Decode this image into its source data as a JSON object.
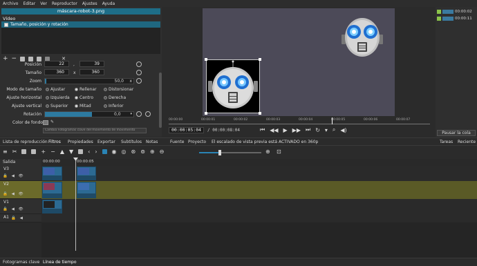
{
  "menu": [
    "Archivo",
    "Editar",
    "Ver",
    "Reproductor",
    "Ajustes",
    "Ayuda"
  ],
  "filters": {
    "title": "máscara-robot-3.png",
    "video_label": "Vídeo",
    "items": [
      {
        "label": "Tamaño, posición y rotación",
        "checked": true
      }
    ]
  },
  "props": {
    "posicion_label": "Posición",
    "pos_x": "22",
    "pos_y": "39",
    "tamano_label": "Tamaño",
    "size_w": "360",
    "size_h": "360",
    "zoom_label": "Zoom",
    "zoom_value": "50,0",
    "modo_label": "Modo de tamaño",
    "modo_options": [
      "Ajustar",
      "Rellenar",
      "Distorsionar"
    ],
    "horiz_label": "Ajuste horizontal",
    "horiz_options": [
      "Izquierda",
      "Centro",
      "Derecha"
    ],
    "vert_label": "Ajuste vertical",
    "vert_options": [
      "Superior",
      "Mitad",
      "Inferior"
    ],
    "rot_label": "Rotación",
    "rot_value": "0,0",
    "fondo_label": "Color de fondo",
    "keyframes_hint": "Cambia Fotogramas clave del movimiento de movimiento"
  },
  "player": {
    "ruler": [
      "00:00:00",
      "00:00:01",
      "00:00:02",
      "00:00:03",
      "00:00:04",
      "00:00:05",
      "00:00:06",
      "00:00:07"
    ],
    "position": "00:00:05:04",
    "duration": "/ 00:00:08:04"
  },
  "jobs": [
    {
      "label": "00:00:02"
    },
    {
      "label": "00:00:11"
    }
  ],
  "right_panel": {
    "pause": "Pausar la cola",
    "tabs": [
      "Tareas",
      "Reciente"
    ]
  },
  "tabs_bar": {
    "left": [
      "Lista de reproducción",
      "Filtros",
      "Propiedades",
      "Exportar",
      "Subtítulos",
      "Notas"
    ],
    "source": "Fuente",
    "project": "Proyecto",
    "status": "El escalado de vista previa está ACTIVADO en 360p"
  },
  "timeline": {
    "output_label": "Salida",
    "ruler": [
      "00:00:00",
      "00:00:05"
    ],
    "tracks": [
      "V3",
      "V2",
      "V1",
      "A1"
    ]
  },
  "bottom_tabs": [
    "Fotogramas clave",
    "Línea de tiempo"
  ],
  "colors": {
    "accent": "#1e6e88",
    "clip": "#2c6a93",
    "selected_track": "#6b6a2a",
    "canvas": "#4c4a58"
  }
}
